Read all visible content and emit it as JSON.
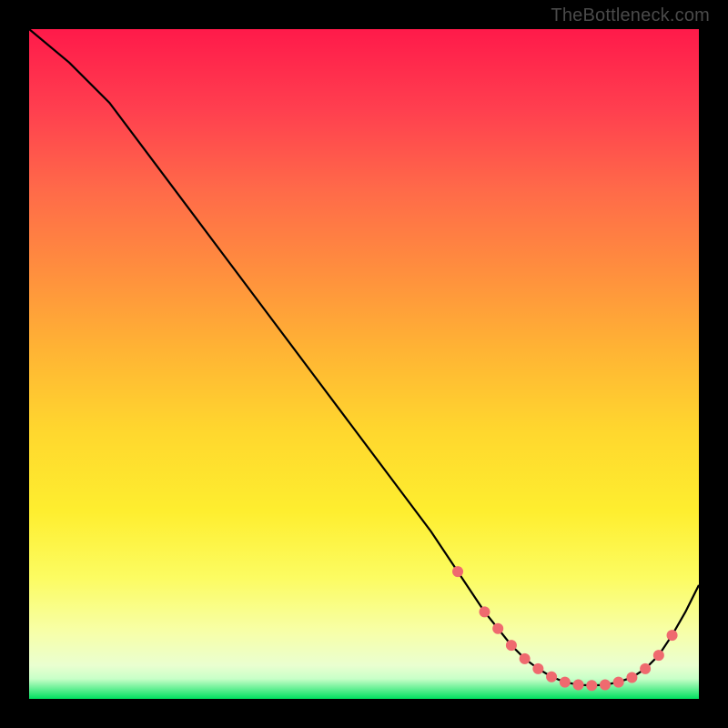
{
  "attribution": "TheBottleneck.com",
  "chart_data": {
    "type": "line",
    "title": "",
    "xlabel": "",
    "ylabel": "",
    "xlim": [
      0,
      100
    ],
    "ylim": [
      0,
      100
    ],
    "curve": {
      "x": [
        0,
        6,
        12,
        18,
        24,
        30,
        36,
        42,
        48,
        54,
        60,
        64,
        66,
        68,
        70,
        72,
        74,
        76,
        78,
        80,
        82,
        84,
        86,
        88,
        90,
        92,
        94,
        96,
        98,
        100
      ],
      "y": [
        100,
        95,
        89,
        81,
        73,
        65,
        57,
        49,
        41,
        33,
        25,
        19,
        16,
        13,
        10.5,
        8,
        6,
        4.5,
        3.3,
        2.5,
        2.1,
        2.0,
        2.1,
        2.5,
        3.2,
        4.5,
        6.5,
        9.5,
        13,
        17
      ]
    },
    "marker_indices": [
      11,
      13,
      14,
      15,
      16,
      17,
      18,
      19,
      20,
      21,
      22,
      23,
      24,
      25,
      26,
      27
    ],
    "marker_color": "#ef6a6f",
    "line_color": "#000000"
  }
}
